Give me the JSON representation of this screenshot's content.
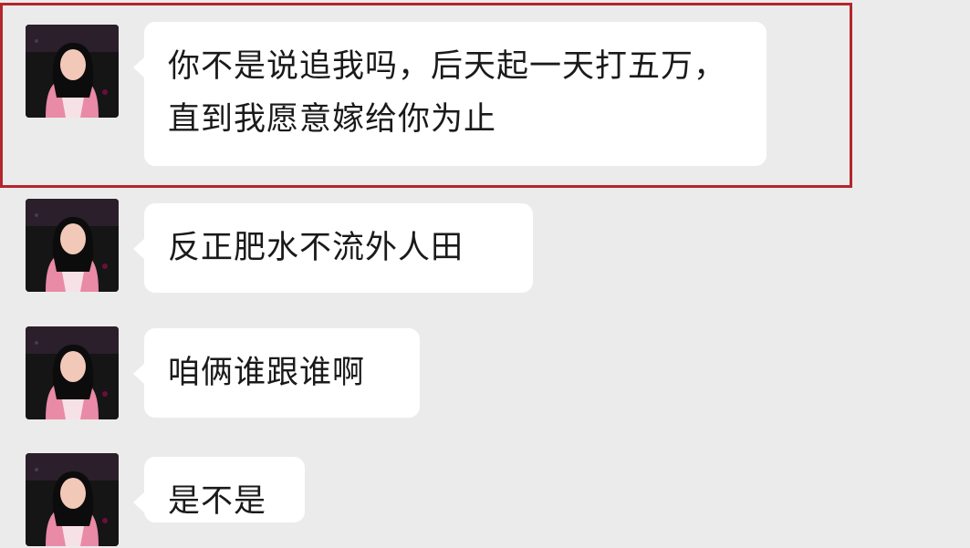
{
  "messages": [
    {
      "text": "你不是说追我吗，后天起一天打五万，直到我愿意嫁给你为止",
      "avatar": "avatar"
    },
    {
      "text": "反正肥水不流外人田",
      "avatar": "avatar"
    },
    {
      "text": "咱俩谁跟谁啊",
      "avatar": "avatar"
    },
    {
      "text": "是不是",
      "avatar": "avatar"
    }
  ],
  "colors": {
    "background": "#ebebeb",
    "bubble": "#ffffff",
    "highlight_border": "#b3262c",
    "text": "#1a1a1a"
  }
}
